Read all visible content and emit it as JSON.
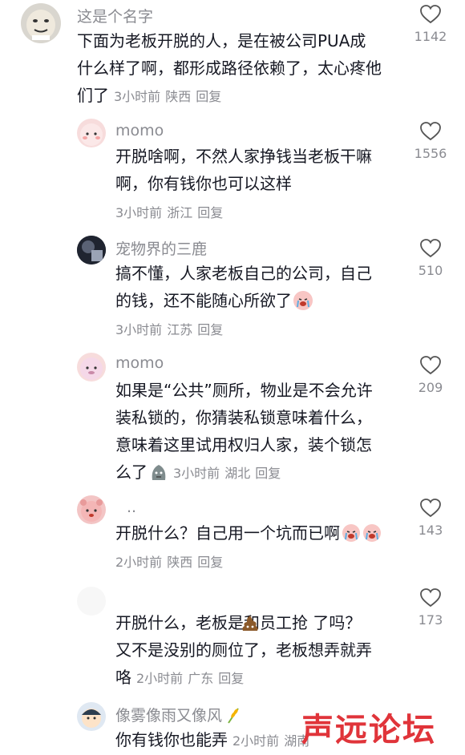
{
  "comments": [
    {
      "user": "这是个名字",
      "lines": [
        "下面为老板开脱的人，是在被公司PUA成",
        "什么样了啊，都形成路径依赖了，太心疼他",
        "们了"
      ],
      "time": "3小时前",
      "location": "陕西",
      "reply": "回复",
      "likes": "1142",
      "avatar_icon": "meme-face-avatar"
    },
    {
      "user": "momo",
      "lines": [
        "开脱啥啊，不然人家挣钱当老板干嘛",
        "啊，你有钱你也可以这样"
      ],
      "time": "3小时前",
      "location": "浙江",
      "reply": "回复",
      "likes": "1556",
      "avatar_icon": "pink-character-avatar"
    },
    {
      "user": "宠物界的三鹿",
      "lines": [
        "搞不懂，人家老板自己的公司，自己",
        "的钱，还不能随心所欲了"
      ],
      "time": "3小时前",
      "location": "江苏",
      "reply": "回复",
      "likes": "510",
      "avatar_icon": "dark-photo-avatar",
      "emoji": "crying-face-emoji"
    },
    {
      "user": "momo",
      "lines": [
        "如果是“公共”厕所，物业是不会允许",
        "装私锁的，你猜装私锁意味着什么，",
        "意味着这里试用权归人家，装个锁怎",
        "么了"
      ],
      "time": "3小时前",
      "location": "湖北",
      "reply": "回复",
      "likes": "209",
      "avatar_icon": "pink-character-avatar",
      "emoji": "gray-blob-emoji"
    },
    {
      "user": "..",
      "lines": [
        "开脱什么？自己用一个坑而已啊"
      ],
      "time": "2小时前",
      "location": "陕西",
      "reply": "回复",
      "likes": "143",
      "avatar_icon": "pink-bear-avatar",
      "emoji": "crying-face-emoji"
    },
    {
      "user": "",
      "lines": [
        "开脱什么，老板是和员工抢 了吗？",
        "又不是没别的厕位了，老板想弄就弄",
        "咯"
      ],
      "time": "2小时前",
      "location": "广东",
      "reply": "回复",
      "likes": "173",
      "avatar_icon": "blank-avatar",
      "emoji": "poop-emoji"
    },
    {
      "user": "像雾像雨又像风",
      "lines": [
        "你有钱你也能弄"
      ],
      "time": "2小时前",
      "location": "湖南",
      "reply": "回复",
      "likes": "",
      "avatar_icon": "cartoon-boy-avatar",
      "emoji": "wheat-emoji"
    }
  ],
  "watermark": "声远论坛",
  "colors": {
    "text": "#161823",
    "muted": "#8a8b91",
    "watermark": "#e0343a"
  }
}
